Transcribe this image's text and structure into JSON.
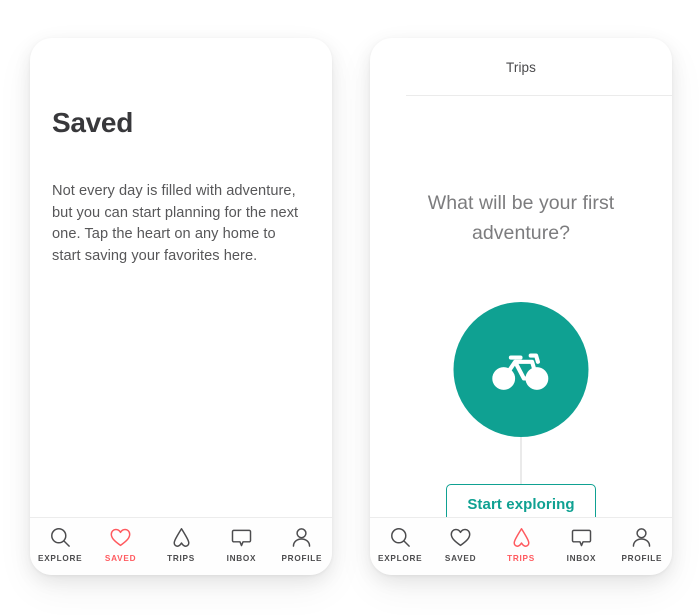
{
  "theme": {
    "accent_red": "#FF5A5F",
    "accent_teal": "#0FA192",
    "text_dark": "#38383B",
    "text_body": "#575759",
    "text_muted": "#7C7C7E",
    "page_background": "#FFFFFF"
  },
  "screens": {
    "saved": {
      "title": "Saved",
      "body": "Not every day is filled with adventure, but you can start planning for the next one. Tap the heart on any home to start saving your favorites here.",
      "tabbar": {
        "active": "SAVED",
        "items": [
          {
            "label": "EXPLORE",
            "icon": "search-icon"
          },
          {
            "label": "SAVED",
            "icon": "heart-icon"
          },
          {
            "label": "TRIPS",
            "icon": "belo-icon"
          },
          {
            "label": "INBOX",
            "icon": "speech-bubble-icon"
          },
          {
            "label": "PROFILE",
            "icon": "person-icon"
          }
        ]
      }
    },
    "trips": {
      "header_title": "Trips",
      "question": "What will be your first adventure?",
      "badge_icon": "bicycle-icon",
      "cta_label": "Start exploring",
      "tabbar": {
        "active": "TRIPS",
        "items": [
          {
            "label": "EXPLORE",
            "icon": "search-icon"
          },
          {
            "label": "SAVED",
            "icon": "heart-icon"
          },
          {
            "label": "TRIPS",
            "icon": "belo-icon"
          },
          {
            "label": "INBOX",
            "icon": "speech-bubble-icon"
          },
          {
            "label": "PROFILE",
            "icon": "person-icon"
          }
        ]
      }
    }
  }
}
